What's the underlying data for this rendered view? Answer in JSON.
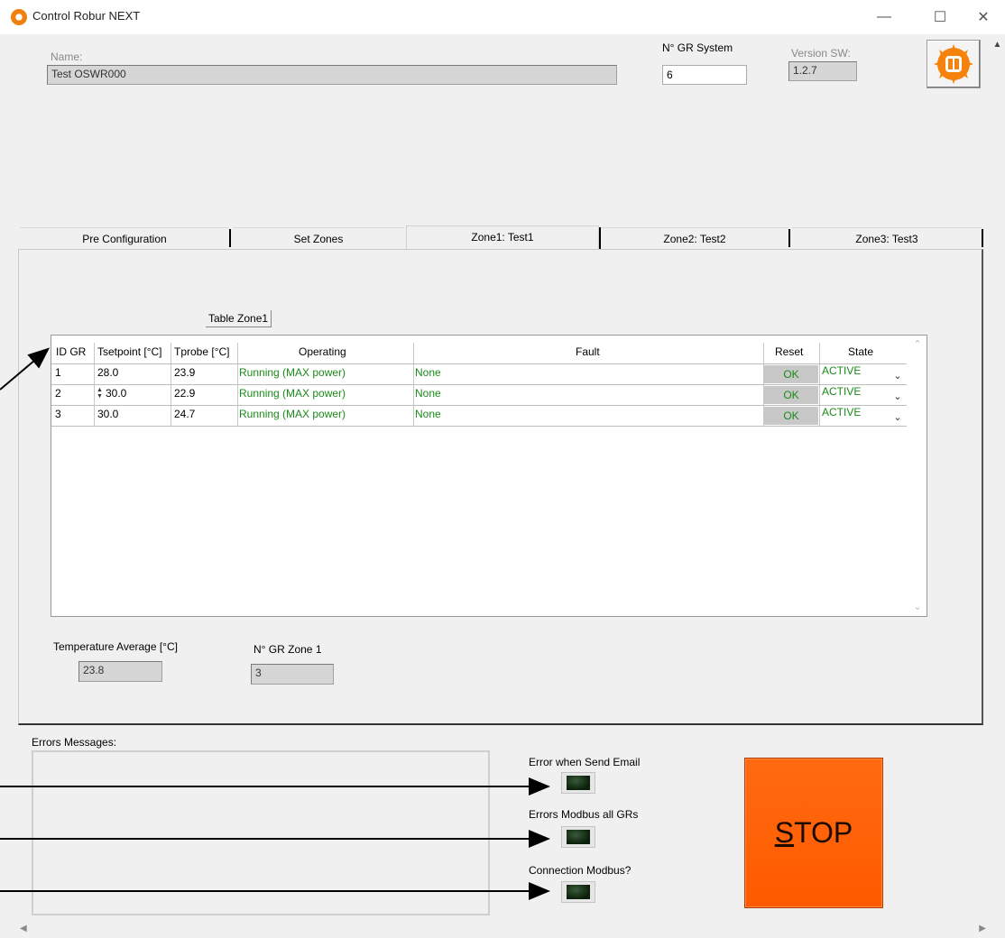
{
  "window": {
    "title": "Control Robur NEXT",
    "minimize": "—",
    "maximize": "☐",
    "close": "✕"
  },
  "header": {
    "name_label": "Name:",
    "name_value": "Test OSWR000",
    "gr_system_label": "N° GR System",
    "gr_system_value": "6",
    "version_label": "Version SW:",
    "version_value": "1.2.7"
  },
  "tabs": [
    {
      "label": "Pre Configuration"
    },
    {
      "label": "Set Zones"
    },
    {
      "label": "Zone1: Test1",
      "active": true
    },
    {
      "label": "Zone2: Test2"
    },
    {
      "label": "Zone3: Test3"
    }
  ],
  "zone": {
    "table_label": "Table Zone1",
    "columns": [
      "ID GR",
      "Tsetpoint [°C]",
      "Tprobe [°C]",
      "Operating",
      "Fault",
      "Reset",
      "State"
    ],
    "rows": [
      {
        "id": "1",
        "tset": "28.0",
        "tprobe": "23.9",
        "operating": "Running (MAX power)",
        "fault": "None",
        "reset": "OK",
        "state": "ACTIVE"
      },
      {
        "id": "2",
        "tset": "30.0",
        "tprobe": "22.9",
        "operating": "Running (MAX power)",
        "fault": "None",
        "reset": "OK",
        "state": "ACTIVE"
      },
      {
        "id": "3",
        "tset": "30.0",
        "tprobe": "24.7",
        "operating": "Running (MAX power)",
        "fault": "None",
        "reset": "OK",
        "state": "ACTIVE"
      }
    ],
    "temp_avg_label": "Temperature Average [°C]",
    "temp_avg_value": "23.8",
    "gr_zone_label": "N° GR Zone 1",
    "gr_zone_value": "3"
  },
  "status": {
    "errors_label": "Errors Messages:",
    "email_error_label": "Error when Send Email",
    "modbus_errors_label": "Errors Modbus all GRs",
    "modbus_conn_label": "Connection Modbus?"
  },
  "stop": {
    "rest": "TOP",
    "underline_letter": "S"
  },
  "colors": {
    "stop": "#ff5a00",
    "ok_text": "#1a8a1a",
    "led_off": "#0b200b"
  }
}
